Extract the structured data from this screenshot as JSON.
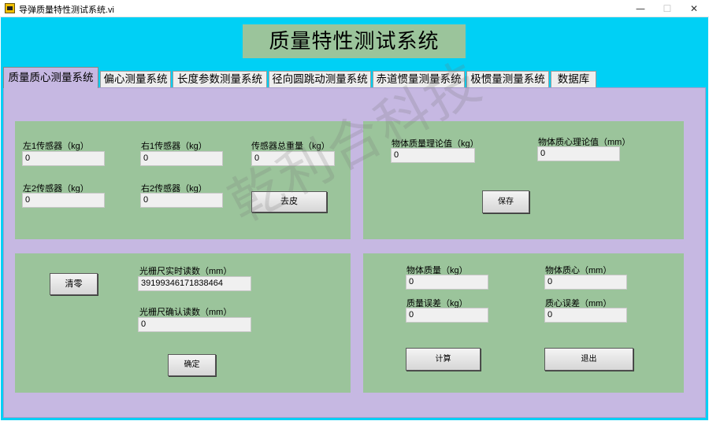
{
  "window": {
    "title": "导弹质量特性测试系统.vi",
    "min_glyph": "—",
    "max_glyph": "☐",
    "close_glyph": "✕"
  },
  "header": {
    "title": "质量特性测试系统"
  },
  "tabs": [
    {
      "label": "质量质心测量系统",
      "active": true
    },
    {
      "label": "偏心测量系统"
    },
    {
      "label": "长度参数测量系统"
    },
    {
      "label": "径向圆跳动测量系统"
    },
    {
      "label": "赤道惯量测量系统"
    },
    {
      "label": "极惯量测量系统"
    },
    {
      "label": "数据库"
    }
  ],
  "sensors": {
    "left1_label": "左1传感器（kg）",
    "left1_value": "0",
    "right1_label": "右1传感器（kg）",
    "right1_value": "0",
    "total_label": "传感器总重量（kg）",
    "total_value": "0",
    "left2_label": "左2传感器（kg）",
    "left2_value": "0",
    "right2_label": "右2传感器（kg）",
    "right2_value": "0",
    "tare_button": "去皮"
  },
  "theory": {
    "mass_label": "物体质量理论值（kg）",
    "mass_value": "0",
    "centroid_label": "物体质心理论值（mm）",
    "centroid_value": "0",
    "save_button": "保存"
  },
  "grating": {
    "zero_button": "清零",
    "realtime_label": "光栅尺实时读数（mm）",
    "realtime_value": "39199346171838464",
    "confirm_label": "光栅尺确认读数（mm）",
    "confirm_value": "0",
    "confirm_button": "确定"
  },
  "results": {
    "mass_label": "物体质量（kg）",
    "mass_value": "0",
    "centroid_label": "物体质心（mm）",
    "centroid_value": "0",
    "mass_error_label": "质量误差（kg）",
    "mass_error_value": "0",
    "centroid_error_label": "质心误差（mm）",
    "centroid_error_value": "0",
    "compute_button": "计算",
    "exit_button": "退出"
  },
  "watermark": "乾利合科技"
}
